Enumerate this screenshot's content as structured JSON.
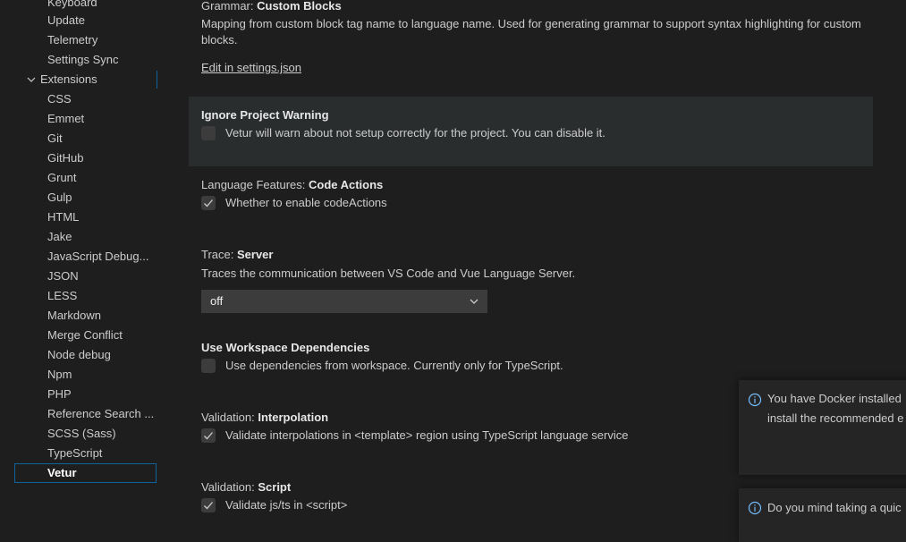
{
  "sidebar": {
    "items": [
      {
        "label": "Keyboard",
        "type": "child"
      },
      {
        "label": "Update",
        "type": "child"
      },
      {
        "label": "Telemetry",
        "type": "child"
      },
      {
        "label": "Settings Sync",
        "type": "child"
      },
      {
        "label": "Extensions",
        "type": "group"
      },
      {
        "label": "CSS",
        "type": "child"
      },
      {
        "label": "Emmet",
        "type": "child"
      },
      {
        "label": "Git",
        "type": "child"
      },
      {
        "label": "GitHub",
        "type": "child"
      },
      {
        "label": "Grunt",
        "type": "child"
      },
      {
        "label": "Gulp",
        "type": "child"
      },
      {
        "label": "HTML",
        "type": "child"
      },
      {
        "label": "Jake",
        "type": "child"
      },
      {
        "label": "JavaScript Debug...",
        "type": "child"
      },
      {
        "label": "JSON",
        "type": "child"
      },
      {
        "label": "LESS",
        "type": "child"
      },
      {
        "label": "Markdown",
        "type": "child"
      },
      {
        "label": "Merge Conflict",
        "type": "child"
      },
      {
        "label": "Node debug",
        "type": "child"
      },
      {
        "label": "Npm",
        "type": "child"
      },
      {
        "label": "PHP",
        "type": "child"
      },
      {
        "label": "Reference Search ...",
        "type": "child"
      },
      {
        "label": "SCSS (Sass)",
        "type": "child"
      },
      {
        "label": "TypeScript",
        "type": "child"
      },
      {
        "label": "Vetur",
        "type": "selected"
      }
    ]
  },
  "settings": {
    "grammar": {
      "category": "Grammar: ",
      "name": "Custom Blocks",
      "description": "Mapping from custom block tag name to language name. Used for generating grammar to support syntax highlighting for custom blocks.",
      "link": "Edit in settings.json"
    },
    "ignore_warning": {
      "name": "Ignore Project Warning",
      "description": "Vetur will warn about not setup correctly for the project. You can disable it.",
      "checked": false
    },
    "code_actions": {
      "category": "Language Features: ",
      "name": "Code Actions",
      "description": "Whether to enable codeActions",
      "checked": true
    },
    "trace": {
      "category": "Trace: ",
      "name": "Server",
      "description": "Traces the communication between VS Code and Vue Language Server.",
      "value": "off"
    },
    "workspace_deps": {
      "name": "Use Workspace Dependencies",
      "description": "Use dependencies from workspace. Currently only for TypeScript.",
      "checked": false
    },
    "interpolation": {
      "category": "Validation: ",
      "name": "Interpolation",
      "description": "Validate interpolations in <template> region using TypeScript language service",
      "checked": true
    },
    "script": {
      "category": "Validation: ",
      "name": "Script",
      "description": "Validate js/ts in <script>",
      "checked": true
    }
  },
  "notifications": [
    {
      "line1": "You have Docker installed",
      "line2": "install the recommended e"
    },
    {
      "line1": "Do you mind taking a quic"
    }
  ],
  "colors": {
    "background": "#1e1e1e",
    "accent": "#0e639c",
    "info": "#75beff"
  }
}
